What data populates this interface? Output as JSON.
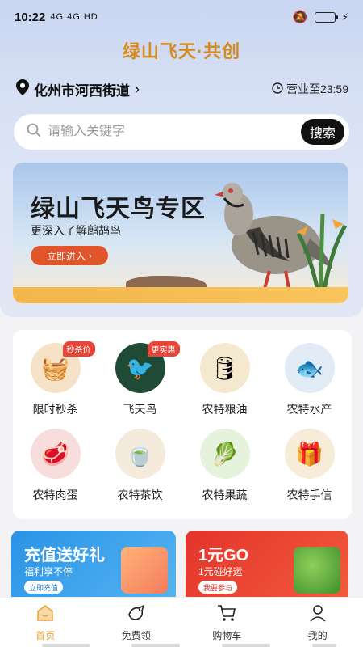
{
  "status_bar": {
    "time": "10:22",
    "signal": "4G 4G HD",
    "icons": [
      "mute-icon",
      "battery-icon",
      "charging-icon"
    ]
  },
  "header": {
    "app_title": "绿山飞天·共创"
  },
  "location": {
    "address": "化州市河西街道",
    "hours": "营业至23:59"
  },
  "search": {
    "placeholder": "请输入关键字",
    "button": "搜索"
  },
  "banner": {
    "title": "绿山飞天鸟专区",
    "subtitle": "更深入了解鹧鸪鸟",
    "button": "立即进入"
  },
  "categories": [
    {
      "label": "限时秒杀",
      "tag": "秒杀价",
      "icon": "basket-icon",
      "color": "#f6e3c7"
    },
    {
      "label": "飞天鸟",
      "tag": "更实惠",
      "icon": "bird-icon",
      "color": "#1f4a35"
    },
    {
      "label": "农特粮油",
      "tag": "",
      "icon": "rice-oil-icon",
      "color": "#f4e9cf"
    },
    {
      "label": "农特水产",
      "tag": "",
      "icon": "fish-icon",
      "color": "#e0ebf5"
    },
    {
      "label": "农特肉蛋",
      "tag": "",
      "icon": "meat-icon",
      "color": "#f7dedd"
    },
    {
      "label": "农特茶饮",
      "tag": "",
      "icon": "tea-icon",
      "color": "#f5ebdc"
    },
    {
      "label": "农特果蔬",
      "tag": "",
      "icon": "vegetable-icon",
      "color": "#e6f3dc"
    },
    {
      "label": "农特手信",
      "tag": "",
      "icon": "gift-box-icon",
      "color": "#f6ecd8"
    }
  ],
  "promos": [
    {
      "title": "充值送好礼",
      "subtitle": "福利享不停",
      "button": "立即充值",
      "color": "#2a93e6"
    },
    {
      "title": "1元GO",
      "subtitle": "1元碰好运",
      "button": "我要参与",
      "color": "#e3342c"
    }
  ],
  "tabbar": [
    {
      "label": "首页",
      "icon": "home-icon",
      "active": true
    },
    {
      "label": "免费领",
      "icon": "bird-outline-icon",
      "active": false
    },
    {
      "label": "购物车",
      "icon": "cart-icon",
      "active": false
    },
    {
      "label": "我的",
      "icon": "user-icon",
      "active": false
    }
  ],
  "colors": {
    "accent": "#e8a23d",
    "title": "#d58b1d",
    "banner_button": "#e2552b",
    "tag": "#e8453a"
  }
}
